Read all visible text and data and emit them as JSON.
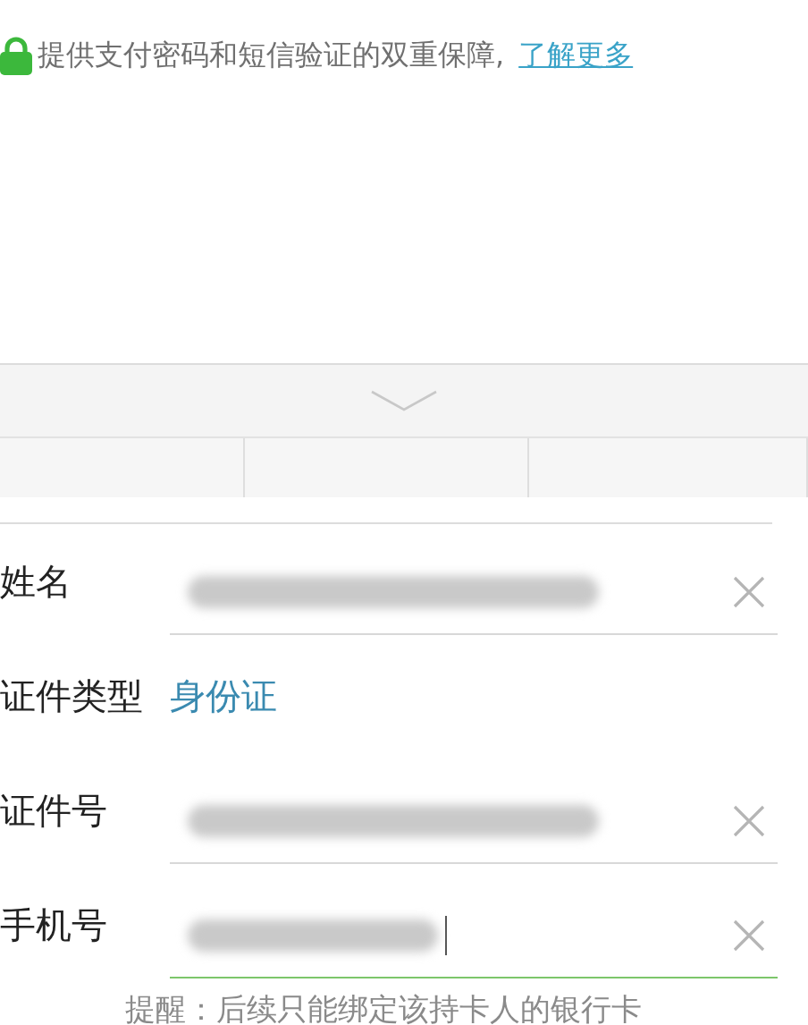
{
  "security_note": {
    "text": "提供支付密码和短信验证的双重保障,",
    "link": "了解更多"
  },
  "form": {
    "fields": [
      {
        "label": "姓名",
        "kind": "input",
        "blurred": true,
        "focused": false
      },
      {
        "label": "证件类型",
        "kind": "select",
        "value": "身份证"
      },
      {
        "label": "证件号",
        "kind": "input",
        "blurred": true,
        "focused": false
      },
      {
        "label": "手机号",
        "kind": "input",
        "blurred": true,
        "focused": true
      }
    ],
    "reminder": "提醒：后续只能绑定该持卡人的银行卡"
  }
}
